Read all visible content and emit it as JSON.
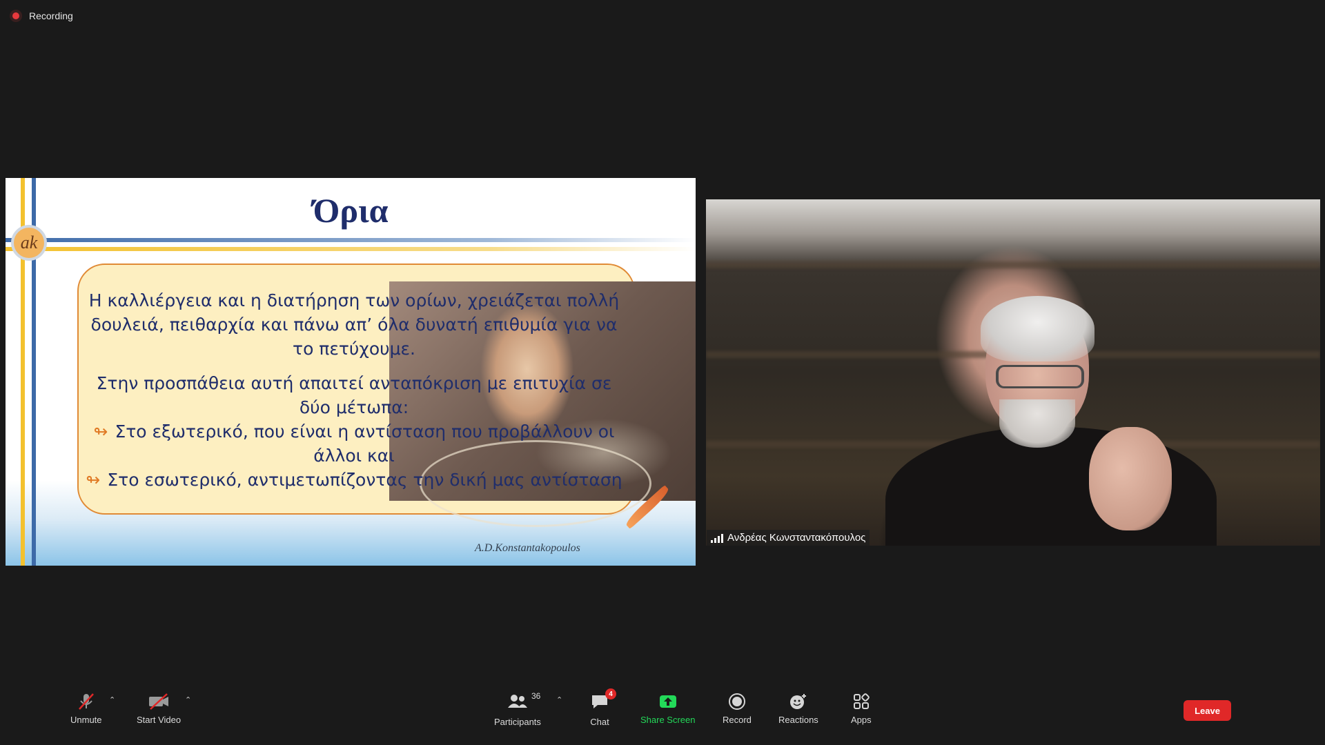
{
  "recording": {
    "label": "Recording"
  },
  "slide": {
    "title": "Όρια",
    "logo_text": "ak",
    "paragraph1_lines": [
      "Η καλλιέργεια και η διατήρηση των ορίων, χρειάζεται πολλή",
      "δουλειά, πειθαρχία και πάνω απ’ όλα δυνατή επιθυμία για να",
      "το πετύχουμε."
    ],
    "paragraph2_lines": [
      "Στην προσπάθεια αυτή απαιτεί ανταπόκριση με επιτυχία σε",
      "δύο μέτωπα:"
    ],
    "bullet1_lines": [
      "Στο εξωτερικό, που είναι η αντίσταση που προβάλλουν οι",
      "άλλοι και"
    ],
    "bullet2_line": "Στο εσωτερικό, αντιμετωπίζοντας την δική μας αντίσταση",
    "bullet_glyph": "↬",
    "signature": "A.D.Konstantakopoulos",
    "colors": {
      "title": "#1f2d6b",
      "box_fill": "#fdefc1",
      "box_border": "#e08a35",
      "stripe_blue": "#3d6aa8",
      "stripe_yellow": "#f3c12e"
    }
  },
  "video": {
    "participant_name": "Ανδρέας Κωνσταντακόπουλος"
  },
  "toolbar": {
    "unmute": "Unmute",
    "start_video": "Start Video",
    "participants": "Participants",
    "participants_count": "36",
    "chat": "Chat",
    "chat_badge": "4",
    "share_screen": "Share Screen",
    "record": "Record",
    "reactions": "Reactions",
    "apps": "Apps",
    "leave": "Leave",
    "colors": {
      "share_green": "#23d959",
      "leave_red": "#e02828"
    }
  }
}
